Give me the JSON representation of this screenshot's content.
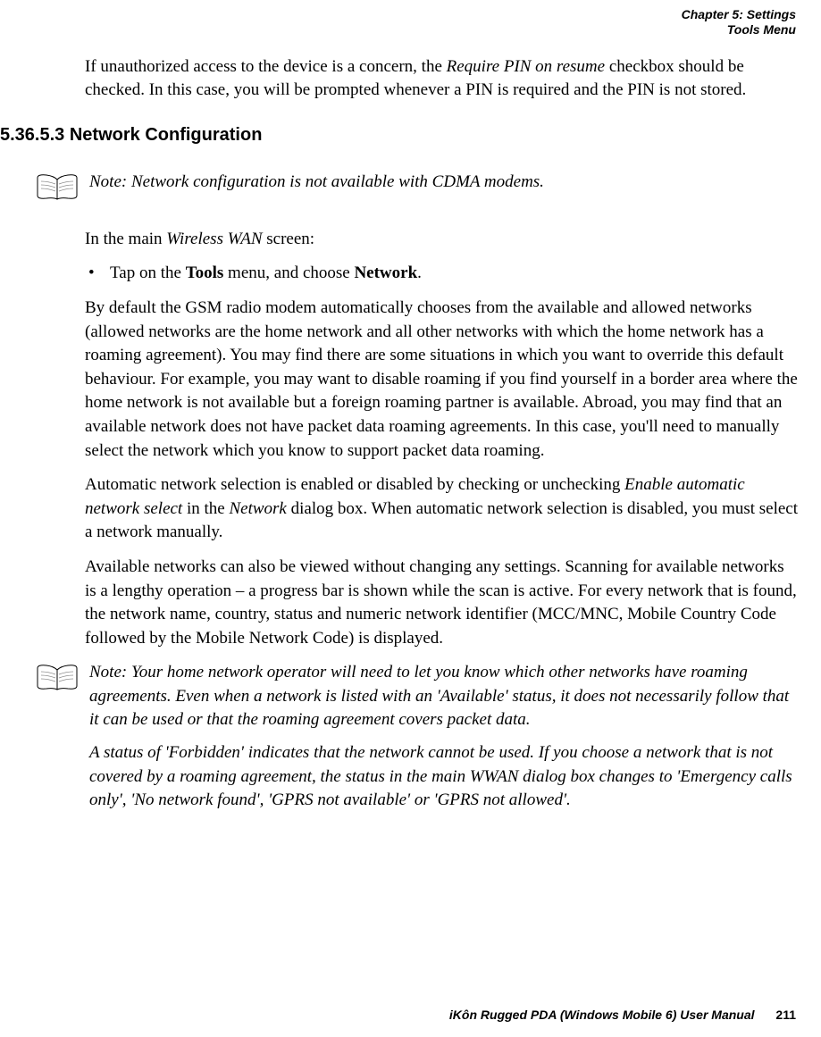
{
  "header": {
    "line1": "Chapter 5: Settings",
    "line2": "Tools Menu"
  },
  "intro": {
    "pre": "If unauthorized access to the device is a concern, the ",
    "italic1": "Require PIN on resume",
    "post": " checkbox should be checked. In this case, you will be prompted whenever a PIN is required and the PIN is not stored."
  },
  "section": {
    "number": "5.36.5.3",
    "title": "Network Configuration"
  },
  "note1": {
    "label": "Note:",
    "text": "Network configuration is not available with CDMA modems."
  },
  "body": {
    "p1_pre": "In the main ",
    "p1_italic": "Wireless WAN",
    "p1_post": " screen:",
    "bullet_pre": "Tap on the ",
    "bullet_bold1": "Tools",
    "bullet_mid": " menu, and choose ",
    "bullet_bold2": "Network",
    "bullet_post": ".",
    "p2": "By default the GSM radio modem automatically chooses from the available and allowed networks (allowed networks are the home network and all other networks with which the home network has a roaming agreement). You may find there are some situations in which you want to override this default behaviour. For example, you may want to disable roaming if you find yourself in a border area where the home network is not available but a foreign roaming partner is available. Abroad, you may find that an available network does not have packet data roaming agreements. In this case, you'll need to manually select the network which you know to support packet data roaming.",
    "p3_pre": "Automatic network selection is enabled or disabled by checking or unchecking ",
    "p3_italic1": "Enable automatic network select",
    "p3_mid": " in the ",
    "p3_italic2": "Network",
    "p3_post": " dialog box. When automatic network selection is disabled, you must select a network manually.",
    "p4": "Available networks can also be viewed without changing any settings. Scanning for available networks is a lengthy operation – a progress bar is shown while the scan is active. For every network that is found, the network name, country, status and numeric network identifier (MCC/MNC, Mobile Country Code followed by the Mobile Network Code) is displayed."
  },
  "note2": {
    "label": "Note:",
    "p1": "Your home network operator will need to let you know which other networks have roaming agreements. Even when a network is listed with an 'Available' status, it does not necessarily follow that it can be used or that the roaming agreement covers packet data.",
    "p2": "A status of 'Forbidden' indicates that the network cannot be used. If you choose a network that is not covered by a roaming agreement, the status in the main WWAN dialog box changes to 'Emergency calls only', 'No network found', 'GPRS not available' or 'GPRS not allowed'."
  },
  "footer": {
    "manual": "iKôn Rugged PDA (Windows Mobile 6) User Manual",
    "page": "211"
  }
}
